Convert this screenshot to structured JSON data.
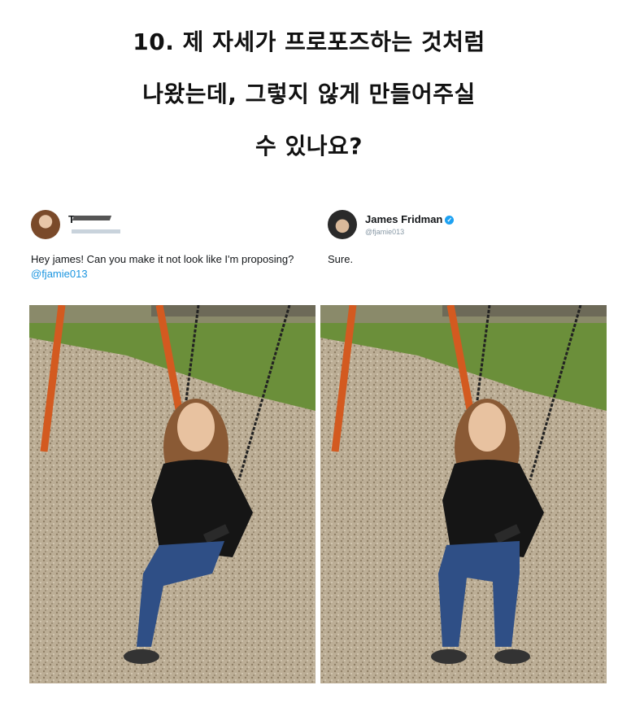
{
  "headline": {
    "line1": "10. 제 자세가 프로포즈하는 것처럼",
    "line2": "나왔는데, 그렇지 않게 만들어주실",
    "line3": "수 있나요?"
  },
  "tweet_left": {
    "name": "T",
    "text_prefix": "Hey james! Can you make it not look like I'm proposing? ",
    "mention": "@fjamie013"
  },
  "tweet_right": {
    "name": "James Fridman",
    "verified_icon": "verified-badge-icon",
    "handle": "@fjamie013",
    "text": "Sure."
  },
  "colors": {
    "mention": "#1b95e0",
    "verified": "#1da1f2",
    "swing_pole": "#d9571e",
    "grass": "#5d8a2f",
    "mulch": "#b9a990",
    "jeans": "#2f4f86",
    "top": "#151515"
  },
  "photos": {
    "original": "original swing photo",
    "edited": "edited swing photo"
  }
}
